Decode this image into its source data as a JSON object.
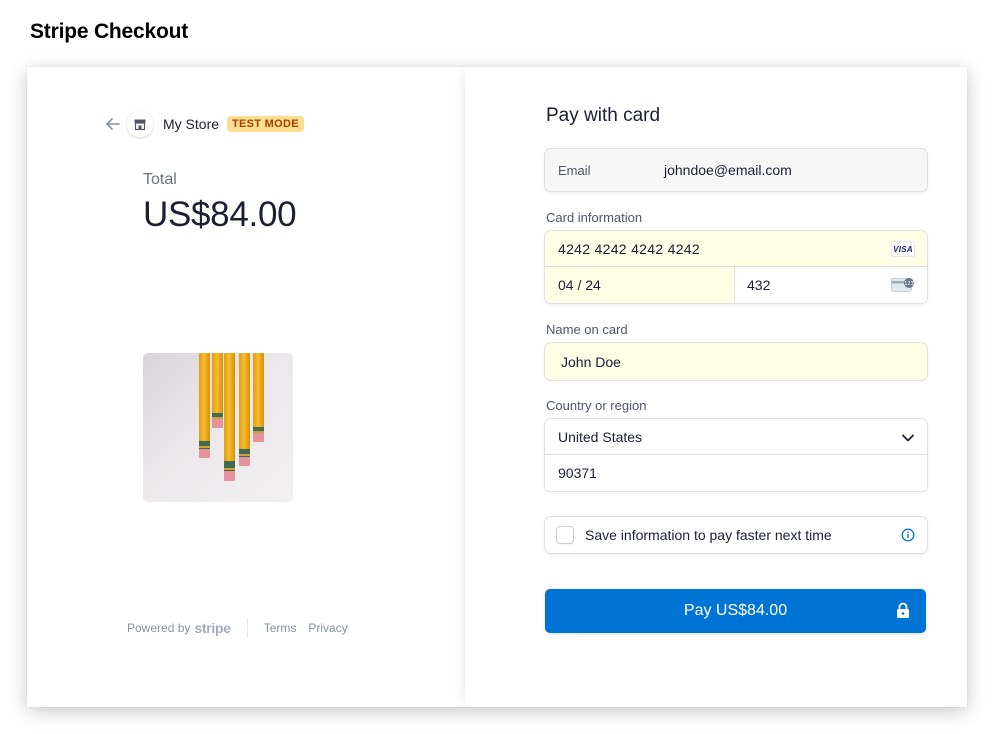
{
  "page": {
    "heading": "Stripe Checkout"
  },
  "store": {
    "name": "My Store",
    "badge": "TEST MODE"
  },
  "summary": {
    "total_label": "Total",
    "total_amount": "US$84.00"
  },
  "footer": {
    "powered_by": "Powered by",
    "brand": "stripe",
    "terms": "Terms",
    "privacy": "Privacy"
  },
  "form": {
    "title": "Pay with card",
    "email": {
      "label": "Email",
      "value": "johndoe@email.com"
    },
    "card": {
      "label": "Card information",
      "number": "4242 4242 4242 4242",
      "brand": "VISA",
      "expiry": "04 / 24",
      "cvc": "432"
    },
    "name": {
      "label": "Name on card",
      "value": "John Doe"
    },
    "country": {
      "label": "Country or region",
      "selected": "United States",
      "zip": "90371"
    },
    "save_info": {
      "label": "Save information to pay faster next time",
      "checked": false
    },
    "pay_button": "Pay US$84.00"
  },
  "colors": {
    "accent": "#0074d4",
    "autofill": "#fefde5",
    "badge_bg": "#ffde92",
    "badge_text": "#a04100",
    "pencil": "#f2b11c"
  }
}
